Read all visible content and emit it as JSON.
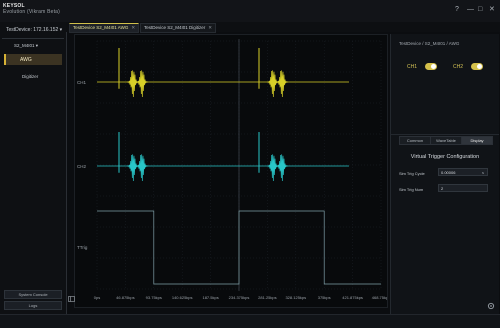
{
  "app": {
    "brand": "KEYSOL",
    "brand_sub": "Evolution (Vikram Beta)",
    "help_glyph": "?",
    "min_glyph": "—",
    "max_glyph": "□",
    "close_glyph": "✕"
  },
  "sidebar": {
    "device": "TestDevice: 172.16.152",
    "device_caret": "▾",
    "module": "S2_M4I01",
    "module_caret": "▾",
    "items": [
      "AWG",
      "Digitizer"
    ],
    "system_console_label": "System Console",
    "logs_label": "Logs"
  },
  "tabs": [
    {
      "label": "TestDevice S2_M4I01 AWG",
      "close": "✕"
    },
    {
      "label": "TestDevice S2_M4I01 Digitizer",
      "close": "✕"
    }
  ],
  "panel": {
    "breadcrumb": "TestDevice  /  S2_M4I01  /  AWG",
    "ch1_label": "CH1",
    "ch2_label": "CH2",
    "ch1_enabled": true,
    "ch2_enabled": true,
    "tabs": [
      "Common",
      "WaveTable",
      "Display"
    ],
    "selected_tab": "Display",
    "section_title": "Virtual Trigger Configuration",
    "sim_trig_cycle_label": "Sim Trig Cycle",
    "sim_trig_cycle_value": "0.00006",
    "sim_trig_cycle_unit": "s",
    "sim_trig_num_label": "Sim Trig Num",
    "sim_trig_num_value": "2"
  },
  "chart_data": {
    "type": "line",
    "channel_labels": [
      "CH1",
      "CH2",
      "TTrig"
    ],
    "x_ticks": [
      "0ps",
      "46.875kps",
      "93.75kps",
      "140.625kps",
      "187.5kps",
      "234.375kps",
      "281.25kps",
      "328.125kps",
      "375kps",
      "421.875kps",
      "468.75kps"
    ],
    "series": [
      {
        "name": "CH1",
        "color": "#d8d028",
        "baseline_level": "mid"
      },
      {
        "name": "CH2",
        "color": "#28c6c8",
        "baseline_level": "mid"
      },
      {
        "name": "TTrig",
        "color": "#7fa0a8",
        "levels": [
          1,
          0,
          1,
          0
        ],
        "transitions_at_tick_index": [
          0,
          2,
          5,
          8
        ]
      }
    ],
    "grid": true
  }
}
